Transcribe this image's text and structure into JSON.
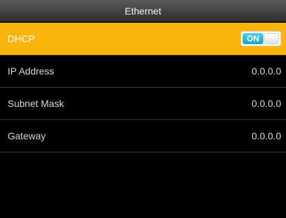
{
  "header": {
    "title": "Ethernet"
  },
  "settings": {
    "dhcp": {
      "label": "DHCP",
      "toggle_label": "ON",
      "enabled": true
    },
    "ip_address": {
      "label": "IP Address",
      "value": "0.0.0.0"
    },
    "subnet_mask": {
      "label": "Subnet Mask",
      "value": "0.0.0.0"
    },
    "gateway": {
      "label": "Gateway",
      "value": "0.0.0.0"
    }
  },
  "colors": {
    "selected_row": "#fbb40c",
    "toggle_on": "#12a7c2",
    "background": "#000000"
  }
}
